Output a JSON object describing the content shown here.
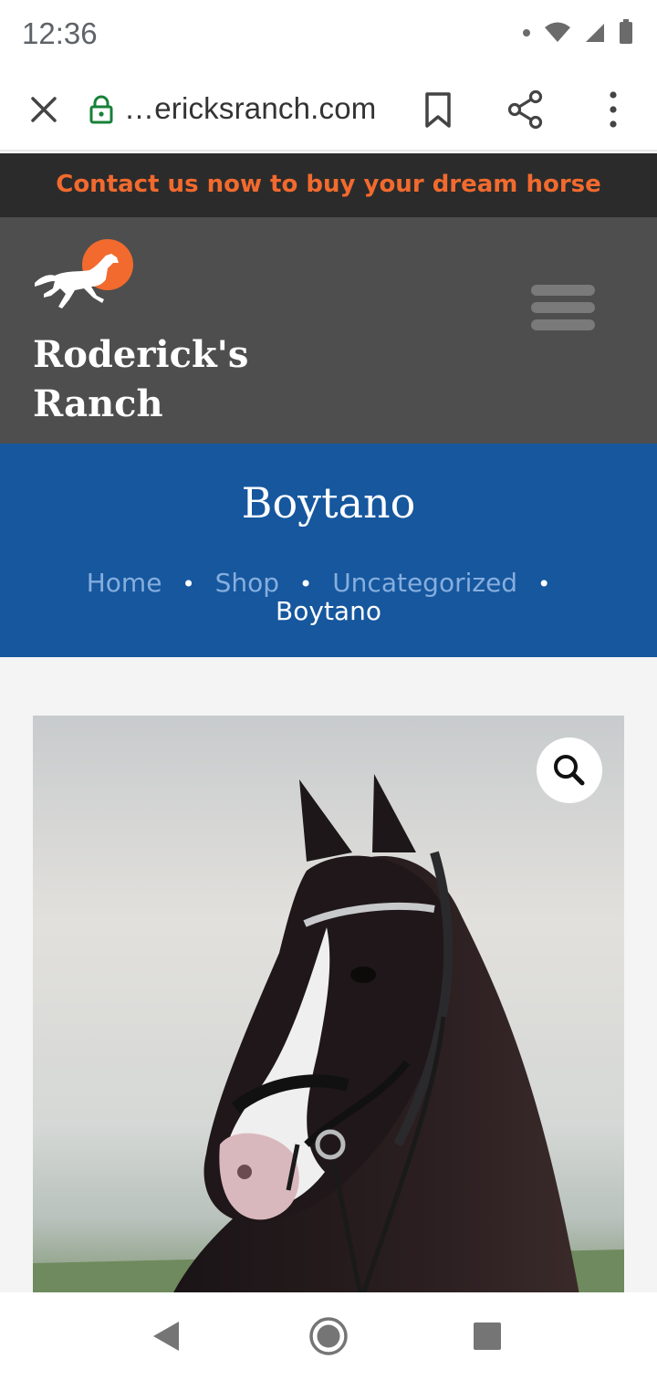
{
  "status_bar": {
    "time": "12:36"
  },
  "browser": {
    "url": "…ericksranch.com"
  },
  "promo": {
    "text": "Contact us now to buy your dream horse",
    "color": "#f26a2e"
  },
  "site": {
    "title_line1": "Roderick's",
    "title_line2": "Ranch"
  },
  "page": {
    "title": "Boytano"
  },
  "breadcrumb": {
    "items": [
      "Home",
      "Shop",
      "Uncategorized"
    ],
    "current": "Boytano"
  },
  "icons": {
    "close": "close-icon",
    "lock": "lock-icon",
    "bookmark": "bookmark-icon",
    "share": "share-icon",
    "menu": "more-vert-icon",
    "hamburger": "hamburger-icon",
    "zoom": "search-icon",
    "back": "nav-back-icon",
    "home": "nav-home-icon",
    "recent": "nav-recents-icon"
  },
  "colors": {
    "header_bg": "#4e4e4e",
    "title_band_bg": "#16579e",
    "promo_bg": "#2b2b2b",
    "accent": "#f26a2e"
  }
}
